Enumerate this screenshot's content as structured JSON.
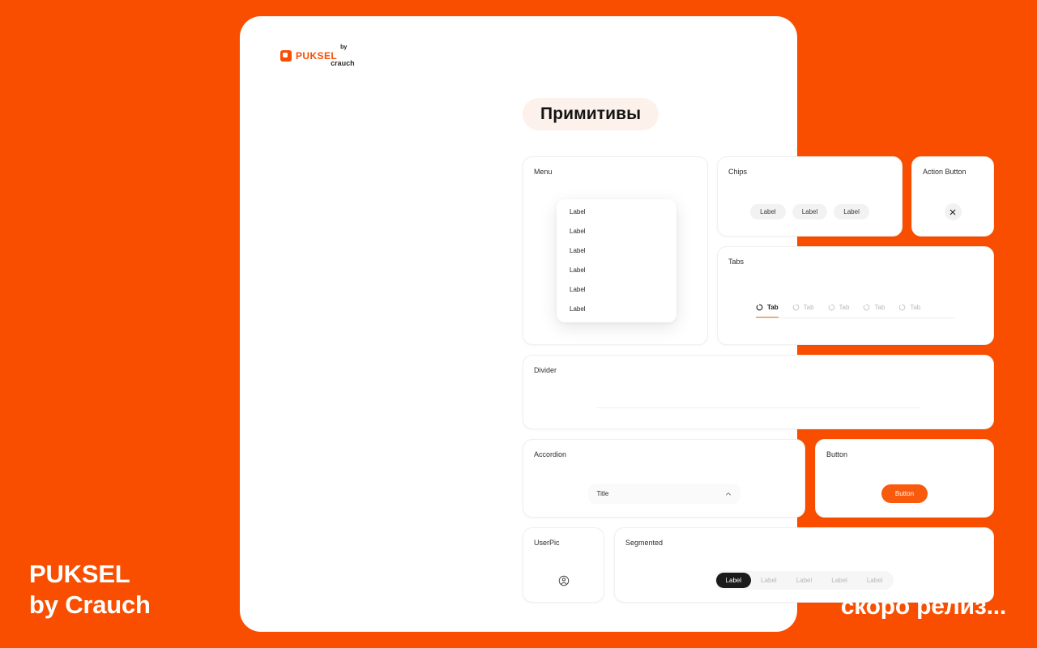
{
  "brand": {
    "logo_word": "PUKSEL",
    "logo_by": "by",
    "logo_crauch": "crauch",
    "logo_mark_icon": "orange-square-icon",
    "accent_color": "#F94E00",
    "button_color": "#F95A0C"
  },
  "page": {
    "title": "Примитивы"
  },
  "cards": {
    "menu": {
      "title": "Menu",
      "items": [
        {
          "label": "Label"
        },
        {
          "label": "Label"
        },
        {
          "label": "Label"
        },
        {
          "label": "Label"
        },
        {
          "label": "Label"
        },
        {
          "label": "Label"
        }
      ]
    },
    "chips": {
      "title": "Chips",
      "items": [
        {
          "label": "Label"
        },
        {
          "label": "Label"
        },
        {
          "label": "Label"
        }
      ]
    },
    "action_button": {
      "title": "Action Button",
      "icon": "close-icon"
    },
    "tabs": {
      "title": "Tabs",
      "items": [
        {
          "label": "Tab",
          "icon": "circle-arc-icon",
          "active": true
        },
        {
          "label": "Tab",
          "icon": "circle-arc-icon",
          "active": false
        },
        {
          "label": "Tab",
          "icon": "circle-arc-icon",
          "active": false
        },
        {
          "label": "Tab",
          "icon": "circle-arc-icon",
          "active": false
        },
        {
          "label": "Tab",
          "icon": "circle-arc-icon",
          "active": false
        }
      ]
    },
    "divider": {
      "title": "Divider"
    },
    "accordion": {
      "title": "Accordion",
      "row_title": "Title",
      "icon": "chevron-up-icon"
    },
    "button": {
      "title": "Button",
      "label": "Button"
    },
    "userpic": {
      "title": "UserPic",
      "icon": "user-circle-icon"
    },
    "segmented": {
      "title": "Segmented",
      "items": [
        {
          "label": "Label",
          "active": true
        },
        {
          "label": "Label",
          "active": false
        },
        {
          "label": "Label",
          "active": false
        },
        {
          "label": "Label",
          "active": false
        },
        {
          "label": "Label",
          "active": false
        }
      ]
    }
  },
  "overlay": {
    "bottom_left_line1": "PUKSEL",
    "bottom_left_line2": "by Crauch",
    "bottom_right": "скоро релиз..."
  }
}
